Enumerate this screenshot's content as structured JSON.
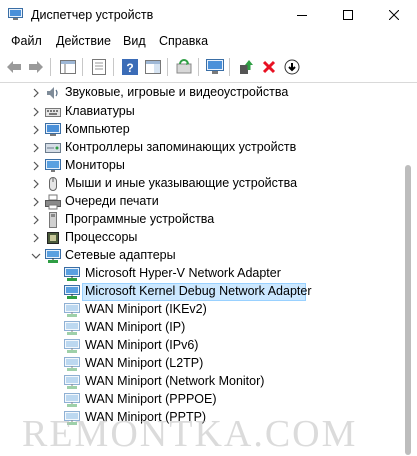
{
  "window": {
    "title": "Диспетчер устройств",
    "app_icon": "device-manager-icon",
    "controls": [
      "minimize",
      "maximize",
      "close"
    ]
  },
  "menu": [
    "Файл",
    "Действие",
    "Вид",
    "Справка"
  ],
  "toolbar": {
    "icons": [
      "back-arrow-icon",
      "forward-arrow-icon",
      "show-hide-tree-icon",
      "properties-icon",
      "help-icon",
      "action-pane-icon",
      "refresh-icon",
      "monitor-scan-icon",
      "update-driver-icon",
      "uninstall-icon",
      "disable-device-icon"
    ]
  },
  "tree": {
    "items": [
      {
        "label": "Звуковые, игровые и видеоустройства",
        "icon": "speaker-icon",
        "expanded": false
      },
      {
        "label": "Клавиатуры",
        "icon": "keyboard-icon",
        "expanded": false
      },
      {
        "label": "Компьютер",
        "icon": "computer-icon",
        "expanded": false
      },
      {
        "label": "Контроллеры запоминающих устройств",
        "icon": "storage-controller-icon",
        "expanded": false
      },
      {
        "label": "Мониторы",
        "icon": "monitor-icon",
        "expanded": false
      },
      {
        "label": "Мыши и иные указывающие устройства",
        "icon": "mouse-icon",
        "expanded": false
      },
      {
        "label": "Очереди печати",
        "icon": "printer-icon",
        "expanded": false
      },
      {
        "label": "Программные устройства",
        "icon": "software-device-icon",
        "expanded": false
      },
      {
        "label": "Процессоры",
        "icon": "processor-icon",
        "expanded": false
      },
      {
        "label": "Сетевые адаптеры",
        "icon": "network-adapter-icon",
        "expanded": true
      }
    ],
    "network_children": [
      {
        "label": "Microsoft Hyper-V Network Adapter",
        "selected": false
      },
      {
        "label": "Microsoft Kernel Debug Network Adapter",
        "selected": true
      },
      {
        "label": "WAN Miniport (IKEv2)",
        "selected": false
      },
      {
        "label": "WAN Miniport (IP)",
        "selected": false
      },
      {
        "label": "WAN Miniport (IPv6)",
        "selected": false
      },
      {
        "label": "WAN Miniport (L2TP)",
        "selected": false
      },
      {
        "label": "WAN Miniport (Network Monitor)",
        "selected": false
      },
      {
        "label": "WAN Miniport (PPPOE)",
        "selected": false
      },
      {
        "label": "WAN Miniport (PPTP)",
        "selected": false
      }
    ]
  },
  "watermark": "REMONTKA.COM",
  "colors": {
    "selection": "#cce8ff",
    "selection_border": "#99d1ff",
    "uninstall_red": "#e81123"
  }
}
